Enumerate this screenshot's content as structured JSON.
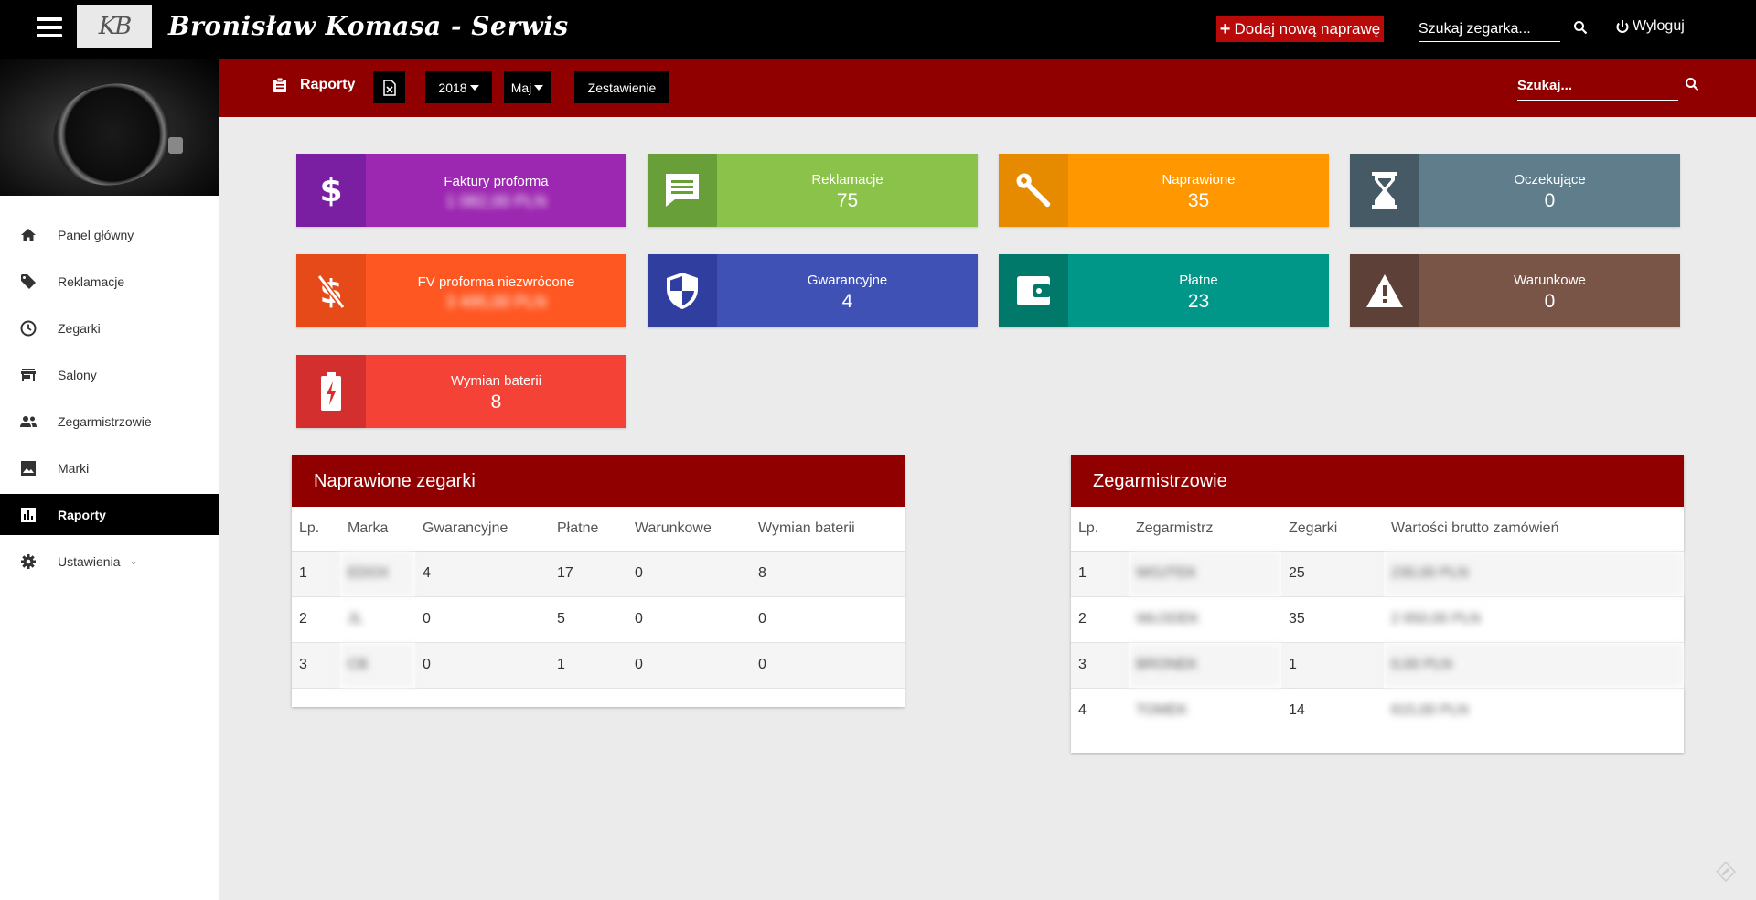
{
  "topbar": {
    "logo_text": "KB",
    "brand": "Bronisław Komasa - Serwis",
    "add_button": "Dodaj nową naprawę",
    "search_placeholder": "Szukaj zegarka...",
    "logout": "Wyloguj"
  },
  "sidebar": {
    "items": [
      {
        "label": "Panel główny",
        "icon": "home-icon"
      },
      {
        "label": "Reklamacje",
        "icon": "tag-icon"
      },
      {
        "label": "Zegarki",
        "icon": "clock-icon"
      },
      {
        "label": "Salony",
        "icon": "store-icon"
      },
      {
        "label": "Zegarmistrzowie",
        "icon": "people-icon"
      },
      {
        "label": "Marki",
        "icon": "image-icon"
      },
      {
        "label": "Raporty",
        "icon": "chart-icon",
        "active": true
      },
      {
        "label": "Ustawienia",
        "icon": "gear-icon"
      }
    ]
  },
  "subbar": {
    "title": "Raporty",
    "year": "2018",
    "month": "Maj",
    "summary": "Zestawienie",
    "search_placeholder": "Szukaj..."
  },
  "cards": [
    {
      "title": "Faktury proforma",
      "value": "1 082,00 PLN",
      "color": "#9c27b0",
      "icon_color": "#7b1fa2",
      "icon": "dollar-icon"
    },
    {
      "title": "Reklamacje",
      "value": "75",
      "color": "#8bc34a",
      "icon_color": "#689f38",
      "icon": "message-icon"
    },
    {
      "title": "Naprawione",
      "value": "35",
      "color": "#ff9800",
      "icon_color": "#e68a00",
      "icon": "wrench-icon"
    },
    {
      "title": "Oczekujące",
      "value": "0",
      "color": "#607d8b",
      "icon_color": "#455a64",
      "icon": "hourglass-icon"
    },
    {
      "title": "FV proforma niezwrócone",
      "value": "3 495,00 PLN",
      "color": "#ff5722",
      "icon_color": "#e64a19",
      "icon": "money-off-icon"
    },
    {
      "title": "Gwarancyjne",
      "value": "4",
      "color": "#3f51b5",
      "icon_color": "#303f9f",
      "icon": "shield-icon"
    },
    {
      "title": "Płatne",
      "value": "23",
      "color": "#009688",
      "icon_color": "#00796b",
      "icon": "wallet-icon"
    },
    {
      "title": "Warunkowe",
      "value": "0",
      "color": "#795548",
      "icon_color": "#5d4037",
      "icon": "warning-icon"
    },
    {
      "title": "Wymian baterii",
      "value": "8",
      "color": "#f44336",
      "icon_color": "#d32f2f",
      "icon": "battery-icon"
    }
  ],
  "repaired": {
    "title": "Naprawione zegarki",
    "headers": [
      "Lp.",
      "Marka",
      "Gwarancyjne",
      "Płatne",
      "Warunkowe",
      "Wymian baterii"
    ],
    "rows": [
      [
        "1",
        "EDOX",
        "4",
        "17",
        "0",
        "8"
      ],
      [
        "2",
        "JL",
        "0",
        "5",
        "0",
        "0"
      ],
      [
        "3",
        "CB",
        "0",
        "1",
        "0",
        "0"
      ]
    ]
  },
  "watchmakers": {
    "title": "Zegarmistrzowie",
    "headers": [
      "Lp.",
      "Zegarmistrz",
      "Zegarki",
      "Wartości brutto zamówień"
    ],
    "rows": [
      [
        "1",
        "WOJTEK",
        "25",
        "230,00 PLN"
      ],
      [
        "2",
        "WŁODEK",
        "35",
        "2 650,00 PLN"
      ],
      [
        "3",
        "BRONEK",
        "1",
        "0,00 PLN"
      ],
      [
        "4",
        "TOMEK",
        "14",
        "615,00 PLN"
      ]
    ]
  }
}
